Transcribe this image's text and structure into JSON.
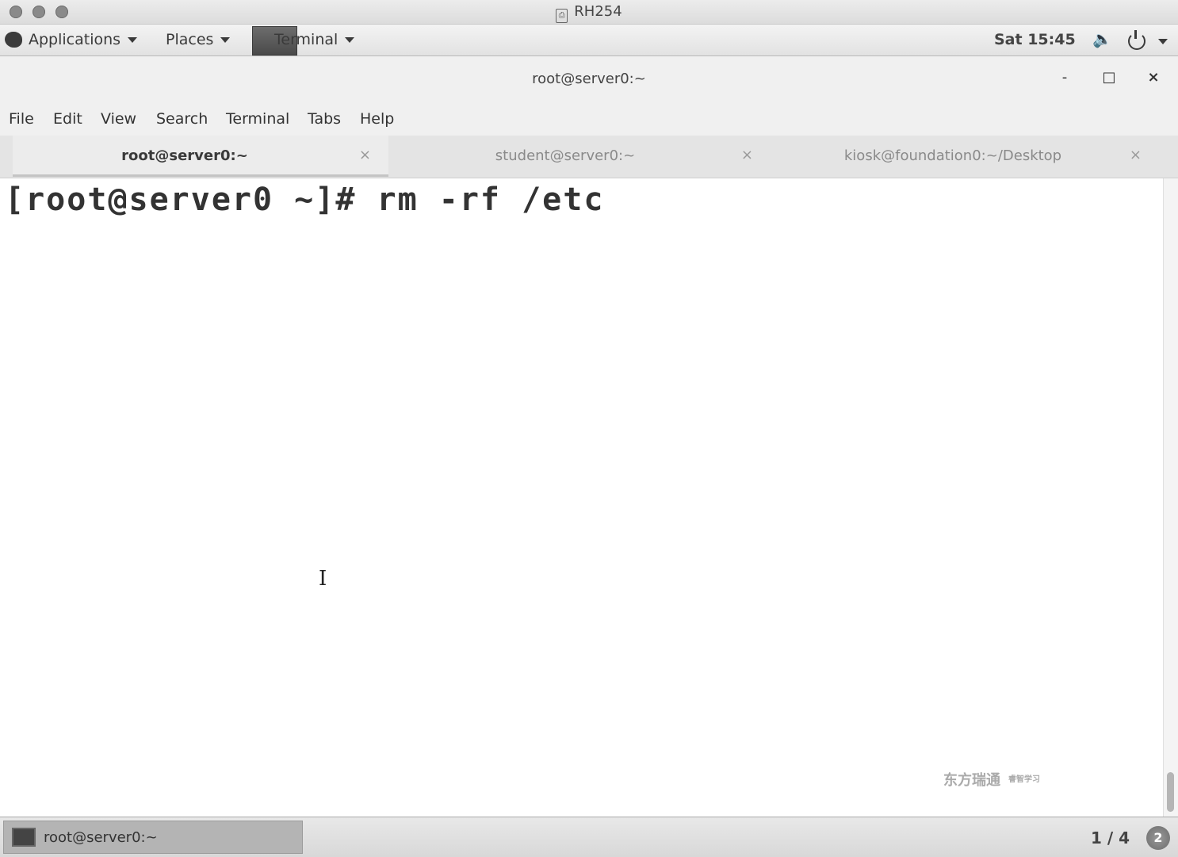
{
  "vm_window": {
    "title": "RH254"
  },
  "topbar": {
    "applications": "Applications",
    "places": "Places",
    "terminal": "Terminal",
    "clock": "Sat 15:45"
  },
  "window": {
    "title": "root@server0:~",
    "minimize": "-",
    "maximize": "□",
    "close": "×"
  },
  "menu": [
    "File",
    "Edit",
    "View",
    "Search",
    "Terminal",
    "Tabs",
    "Help"
  ],
  "tabs": [
    {
      "label": "root@server0:~",
      "active": true
    },
    {
      "label": "student@server0:~",
      "active": false
    },
    {
      "label": "kiosk@foundation0:~/Desktop",
      "active": false
    }
  ],
  "tab_close": "×",
  "terminal": {
    "prompt": "[root@server0 ~]#",
    "command": "rm -rf /etc"
  },
  "watermark": {
    "text": "东方瑞通",
    "sub": "睿智学习"
  },
  "taskbar": {
    "window_label": "root@server0:~",
    "workspace": "1 / 4",
    "notifications": "2"
  },
  "icons": [
    "gnome-foot-icon",
    "terminal-icon",
    "volume-icon",
    "power-icon",
    "document-icon",
    "text-cursor-icon"
  ]
}
